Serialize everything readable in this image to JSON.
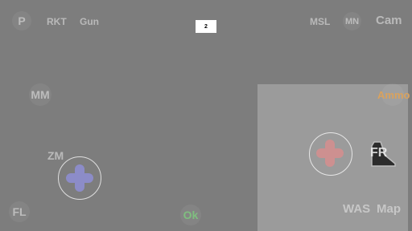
{
  "top_left": {
    "p_label": "P",
    "rkt_label": "RKT",
    "gun_label": "Gun"
  },
  "top_right": {
    "msl_label": "MSL",
    "mn_label": "MN",
    "cam_label": "Cam"
  },
  "counter": {
    "value": "2"
  },
  "left": {
    "mm_label": "MM",
    "zm_label": "ZM",
    "fl_label": "FL"
  },
  "bottom": {
    "ok_label": "Ok"
  },
  "right": {
    "ammo_label": "Ammo",
    "fr_label": "FR",
    "was_label": "WAS",
    "map_label": "Map"
  },
  "joysticks": {
    "left_color": "#8f8fd6",
    "right_color": "#d68f8f"
  },
  "colors": {
    "background": "#7d7d7d",
    "panel": "#9b9b9b",
    "ammo": "#d9a25e",
    "ok": "#7fbf7f"
  },
  "icons": {
    "fire_icon": "trigger-icon"
  }
}
